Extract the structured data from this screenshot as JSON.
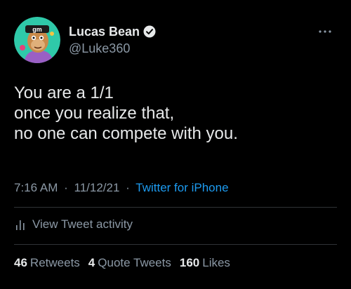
{
  "author": {
    "name": "Lucas Bean",
    "handle": "@Luke360",
    "verified_icon": "verified-badge-icon",
    "avatar_icon": "gm-ape-avatar"
  },
  "tweet": {
    "lines": [
      "You are a 1/1",
      "once you realize that,",
      "no one can compete with you."
    ]
  },
  "meta": {
    "time": "7:16 AM",
    "date": "11/12/21",
    "separator": "·",
    "source": "Twitter for iPhone"
  },
  "activity": {
    "label": "View Tweet activity",
    "icon": "bar-chart-icon"
  },
  "stats": [
    {
      "count": "46",
      "label": "Retweets"
    },
    {
      "count": "4",
      "label": "Quote Tweets"
    },
    {
      "count": "160",
      "label": "Likes"
    }
  ],
  "colors": {
    "background": "#000000",
    "primary_text": "#e7e9ea",
    "secondary_text": "#8b98a5",
    "link": "#1d9bf0",
    "divider": "#2f3336"
  },
  "more_icon": "more-dots-icon"
}
